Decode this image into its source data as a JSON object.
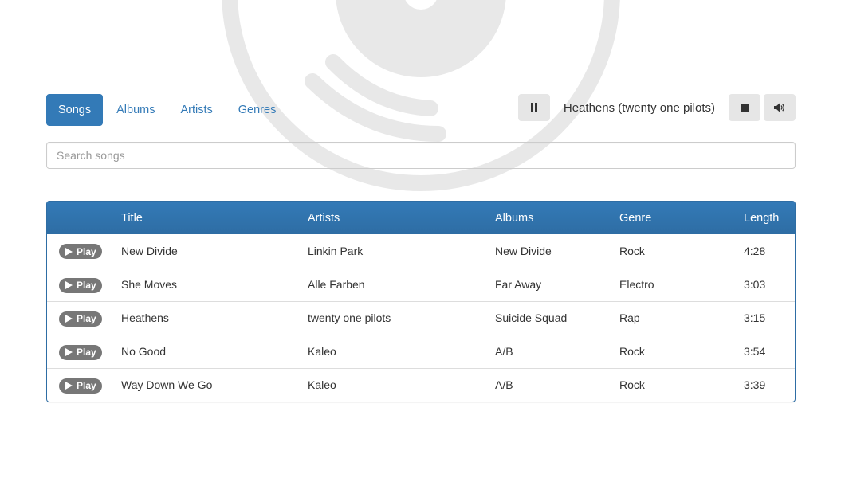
{
  "nav": {
    "tabs": [
      {
        "label": "Songs",
        "active": true
      },
      {
        "label": "Albums",
        "active": false
      },
      {
        "label": "Artists",
        "active": false
      },
      {
        "label": "Genres",
        "active": false
      }
    ]
  },
  "player": {
    "now_playing": "Heathens (twenty one pilots)",
    "pause_icon": "pause-icon",
    "stop_icon": "stop-icon",
    "volume_icon": "volume-icon"
  },
  "search": {
    "placeholder": "Search songs",
    "value": ""
  },
  "table": {
    "columns": [
      "",
      "Title",
      "Artists",
      "Albums",
      "Genre",
      "Length"
    ],
    "play_label": "Play",
    "rows": [
      {
        "title": "New Divide",
        "artist": "Linkin Park",
        "album": "New Divide",
        "genre": "Rock",
        "length": "4:28"
      },
      {
        "title": "She Moves",
        "artist": "Alle Farben",
        "album": "Far Away",
        "genre": "Electro",
        "length": "3:03"
      },
      {
        "title": "Heathens",
        "artist": "twenty one pilots",
        "album": "Suicide Squad",
        "genre": "Rap",
        "length": "3:15"
      },
      {
        "title": "No Good",
        "artist": "Kaleo",
        "album": "A/B",
        "genre": "Rock",
        "length": "3:54"
      },
      {
        "title": "Way Down We Go",
        "artist": "Kaleo",
        "album": "A/B",
        "genre": "Rock",
        "length": "3:39"
      }
    ]
  },
  "colors": {
    "primary": "#337ab7",
    "header_dark": "#2e6da4",
    "badge": "#777777",
    "logo": "#e6e6e6"
  }
}
